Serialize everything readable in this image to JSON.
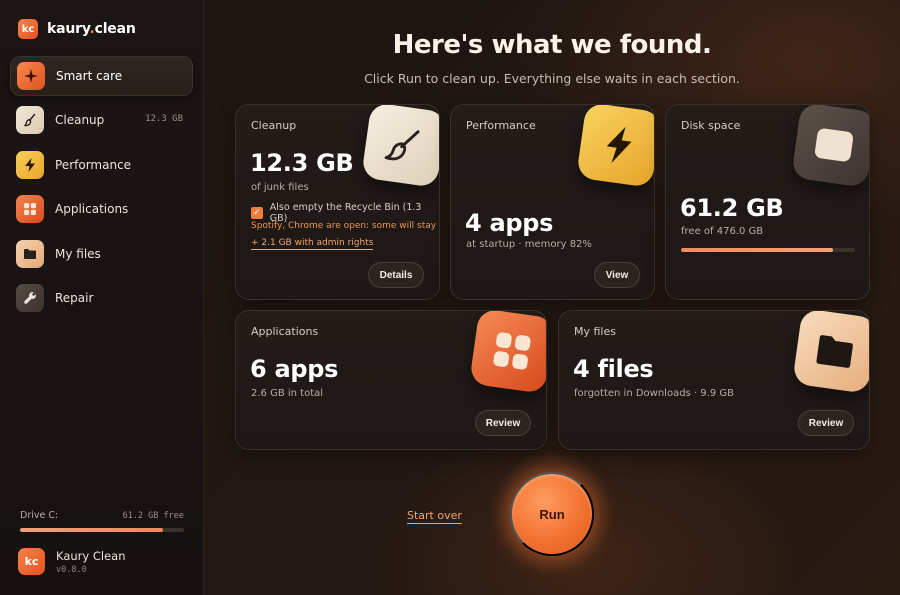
{
  "brand": {
    "logo_text": "kc",
    "name_a": "kaury",
    "name_dot": ".",
    "name_b": "clean"
  },
  "sidebar": {
    "items": [
      {
        "label": "Smart care",
        "icon": "sparkle-icon",
        "active": true,
        "meta": ""
      },
      {
        "label": "Cleanup",
        "icon": "brush-icon",
        "active": false,
        "meta": "12.3 GB"
      },
      {
        "label": "Performance",
        "icon": "bolt-icon",
        "active": false,
        "meta": ""
      },
      {
        "label": "Applications",
        "icon": "apps-grid-icon",
        "active": false,
        "meta": ""
      },
      {
        "label": "My files",
        "icon": "folder-icon",
        "active": false,
        "meta": ""
      },
      {
        "label": "Repair",
        "icon": "wrench-icon",
        "active": false,
        "meta": ""
      }
    ],
    "drive": {
      "label": "Drive C:",
      "free": "61.2 GB free",
      "used_fraction": 0.871
    },
    "about": {
      "logo_text": "kc",
      "name": "Kaury Clean",
      "version": "v0.8.0"
    }
  },
  "main": {
    "headline": "Here's what we found.",
    "subline": "Click Run to clean up. Everything else waits in each section.",
    "cards": {
      "cleanup": {
        "title": "Cleanup",
        "value": "12.3 GB",
        "sub": "of junk files",
        "checkbox_label": "Also empty the Recycle Bin (1.3 GB)",
        "checkbox_checked": true,
        "warning": "Spotify, Chrome are open: some will stay",
        "admin_link": "+ 2.1 GB with admin rights",
        "button": "Details"
      },
      "performance": {
        "title": "Performance",
        "value": "4 apps",
        "sub": "at startup · memory 82%",
        "button": "View"
      },
      "disk": {
        "title": "Disk space",
        "value": "61.2 GB",
        "sub": "free of 476.0 GB",
        "used_fraction": 0.871
      },
      "applications": {
        "title": "Applications",
        "value": "6 apps",
        "sub": "2.6 GB in total",
        "button": "Review"
      },
      "files": {
        "title": "My files",
        "value": "4 files",
        "sub": "forgotten in Downloads · 9.9 GB",
        "button": "Review"
      }
    },
    "start_over": "Start over",
    "run": "Run"
  },
  "colors": {
    "accent": "#f07a3c",
    "background": "#140f0d",
    "card": "#211a17"
  }
}
